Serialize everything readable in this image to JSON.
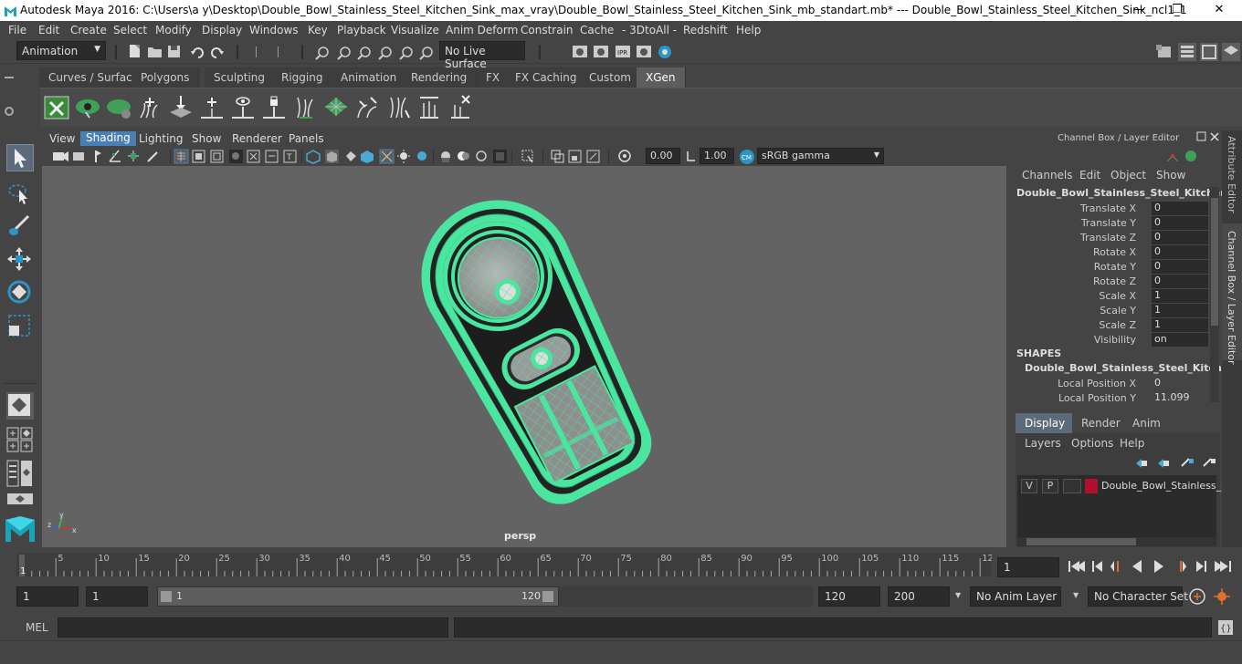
{
  "window": {
    "title": "Autodesk Maya 2016: C:\\Users\\a y\\Desktop\\Double_Bowl_Stainless_Steel_Kitchen_Sink_max_vray\\Double_Bowl_Stainless_Steel_Kitchen_Sink_mb_standart.mb*   ---   Double_Bowl_Stainless_Steel_Kitchen_Sink_ncl1_1",
    "minimize": "—",
    "maximize": "❐",
    "close": "✕"
  },
  "menubar": {
    "items": [
      "File",
      "Edit",
      "Create",
      "Select",
      "Modify",
      "Display",
      "Windows",
      "Key",
      "Playback",
      "Visualize",
      "Anim Deform",
      "Constrain",
      "Cache",
      "- 3DtoAll -",
      "Redshift",
      "Help"
    ]
  },
  "status": {
    "mode": "Animation",
    "live_surface": "No Live Surface"
  },
  "shelf": {
    "tabs": [
      "Curves / Surfaces",
      "Polygons",
      "Sculpting",
      "Rigging",
      "Animation",
      "Rendering",
      "FX",
      "FX Caching",
      "Custom",
      "XGen"
    ],
    "active_tab": "XGen"
  },
  "viewport": {
    "menu": [
      "View",
      "Shading",
      "Lighting",
      "Show",
      "Renderer",
      "Panels"
    ],
    "active_menu": "Shading",
    "exposure": "0.00",
    "gamma": "1.00",
    "color_space": "sRGB gamma",
    "camera_label": "persp"
  },
  "channel_box": {
    "header": "Channel Box / Layer Editor",
    "menu": [
      "Channels",
      "Edit",
      "Object",
      "Show"
    ],
    "object_name": "Double_Bowl_Stainless_Steel_Kitchen_...",
    "channels": [
      {
        "label": "Translate X",
        "value": "0"
      },
      {
        "label": "Translate Y",
        "value": "0"
      },
      {
        "label": "Translate Z",
        "value": "0"
      },
      {
        "label": "Rotate X",
        "value": "0"
      },
      {
        "label": "Rotate Y",
        "value": "0"
      },
      {
        "label": "Rotate Z",
        "value": "0"
      },
      {
        "label": "Scale X",
        "value": "1"
      },
      {
        "label": "Scale Y",
        "value": "1"
      },
      {
        "label": "Scale Z",
        "value": "1"
      },
      {
        "label": "Visibility",
        "value": "on"
      }
    ],
    "shapes_header": "SHAPES",
    "shape_name": "Double_Bowl_Stainless_Steel_Kitche...",
    "shape_channels": [
      {
        "label": "Local Position X",
        "value": "0"
      },
      {
        "label": "Local Position Y",
        "value": "11.099"
      }
    ],
    "layer_tabs": [
      "Display",
      "Render",
      "Anim"
    ],
    "active_layer_tab": "Display",
    "layer_menu": [
      "Layers",
      "Options",
      "Help"
    ],
    "layer": {
      "v": "V",
      "p": "P",
      "name": "Double_Bowl_Stainless_S",
      "color": "#b01030"
    }
  },
  "side_tabs": {
    "attribute_editor": "Attribute Editor",
    "channel_box": "Channel Box / Layer Editor"
  },
  "timeline": {
    "ticks": [
      "5",
      "10",
      "15",
      "20",
      "25",
      "30",
      "35",
      "40",
      "45",
      "50",
      "55",
      "60",
      "65",
      "70",
      "75",
      "80",
      "85",
      "90",
      "95",
      "100",
      "105",
      "110",
      "115",
      "12"
    ],
    "current_marker": "1",
    "current_frame": "1"
  },
  "range": {
    "start": "1",
    "playback_start": "1",
    "slider_start": "1",
    "slider_end": "120",
    "playback_end": "120",
    "end": "200",
    "anim_layer": "No Anim Layer",
    "character_set": "No Character Set"
  },
  "command": {
    "language": "MEL"
  },
  "colors": {
    "wire": "#4ae6a0",
    "highlight_tab": "#5d5d5d",
    "accent_blue": "#4a7fb5"
  }
}
